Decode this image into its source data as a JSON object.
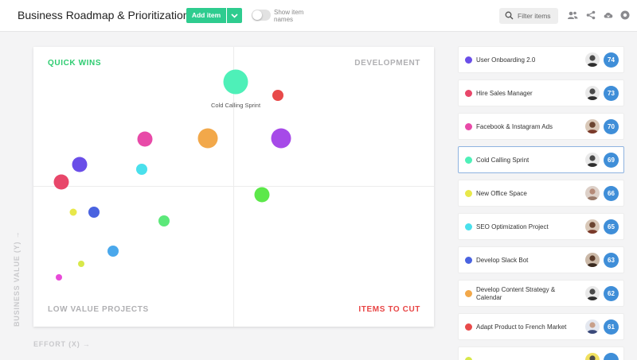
{
  "app": {
    "title": "Business Roadmap & Prioritization"
  },
  "toolbar": {
    "add_label": "Add item",
    "show_names_label": "Show item names",
    "filter_label": "Filter items",
    "accent": "#2ecc8f"
  },
  "matrix": {
    "quadrants": {
      "top_left": {
        "label": "QUICK WINS",
        "color": "#2ecc71"
      },
      "top_right": {
        "label": "DEVELOPMENT",
        "color": "#b0b0b3"
      },
      "bottom_left": {
        "label": "LOW VALUE PROJECTS",
        "color": "#b0b0b3"
      },
      "bottom_right": {
        "label": "ITEMS TO CUT",
        "color": "#e84545"
      }
    },
    "x_axis_label": "EFFORT (X) →",
    "y_axis_label": "BUSINESS VALUE (Y) →",
    "highlighted_label": "Cold Calling Sprint"
  },
  "items": [
    {
      "name": "User Onboarding 2.0",
      "score": "74",
      "color": "#6a4ee8"
    },
    {
      "name": "Hire Sales Manager",
      "score": "73",
      "color": "#e8476a"
    },
    {
      "name": "Facebook & Instagram Ads",
      "score": "70",
      "color": "#e84aa8"
    },
    {
      "name": "Cold Calling Sprint",
      "score": "69",
      "color": "#4ef0b8",
      "selected": true
    },
    {
      "name": "New Office Space",
      "score": "66",
      "color": "#e8e84a"
    },
    {
      "name": "SEO Optimization Project",
      "score": "65",
      "color": "#4ae0ec"
    },
    {
      "name": "Develop Slack Bot",
      "score": "63",
      "color": "#4a63e0"
    },
    {
      "name": "Develop Content Strategy & Calendar",
      "score": "62",
      "color": "#f2a84a"
    },
    {
      "name": "Adapt Product to French Market",
      "score": "61",
      "color": "#e84a4a"
    },
    {
      "name": "",
      "score": "",
      "color": "#d8e84a"
    }
  ]
}
